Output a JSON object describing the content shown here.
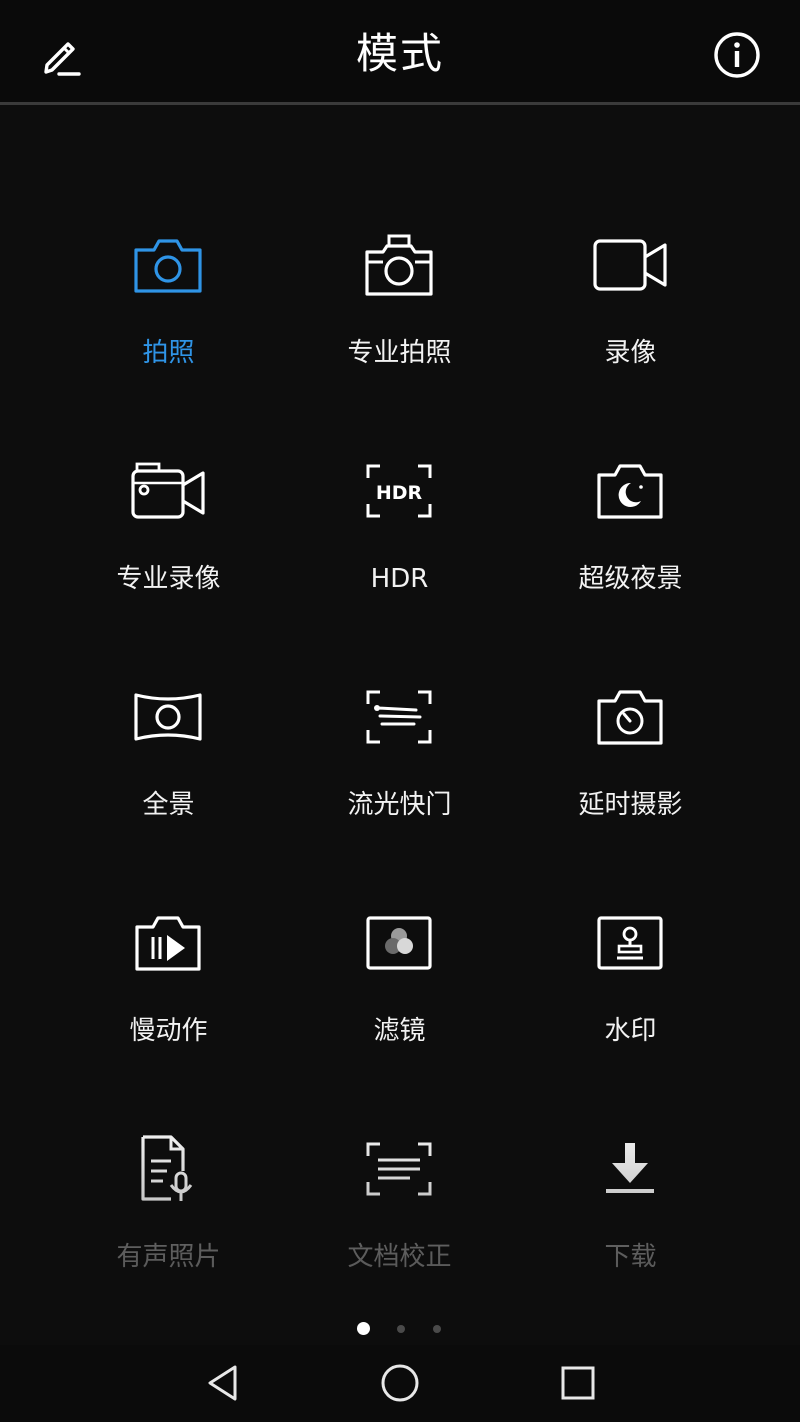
{
  "header": {
    "title": "模式",
    "edit_icon": "pencil-icon",
    "info_icon": "info-icon"
  },
  "colors": {
    "active": "#2f94e6",
    "text": "#f2f2f2",
    "dim_text": "#8a8a8a",
    "background": "#0d0d0d"
  },
  "modes": [
    {
      "label": "拍照",
      "icon": "camera-icon",
      "state": "selected"
    },
    {
      "label": "专业拍照",
      "icon": "pro-camera-icon",
      "state": "normal"
    },
    {
      "label": "录像",
      "icon": "video-camera-icon",
      "state": "normal"
    },
    {
      "label": "专业录像",
      "icon": "pro-video-icon",
      "state": "normal"
    },
    {
      "label": "HDR",
      "icon": "hdr-icon",
      "state": "normal"
    },
    {
      "label": "超级夜景",
      "icon": "night-mode-icon",
      "state": "normal"
    },
    {
      "label": "全景",
      "icon": "panorama-icon",
      "state": "normal"
    },
    {
      "label": "流光快门",
      "icon": "light-painting-icon",
      "state": "normal"
    },
    {
      "label": "延时摄影",
      "icon": "time-lapse-icon",
      "state": "normal"
    },
    {
      "label": "慢动作",
      "icon": "slow-motion-icon",
      "state": "normal"
    },
    {
      "label": "滤镜",
      "icon": "filter-icon",
      "state": "normal"
    },
    {
      "label": "水印",
      "icon": "watermark-icon",
      "state": "normal"
    },
    {
      "label": "有声照片",
      "icon": "audio-note-icon",
      "state": "dim"
    },
    {
      "label": "文档校正",
      "icon": "document-scan-icon",
      "state": "dim"
    },
    {
      "label": "下载",
      "icon": "download-icon",
      "state": "dim"
    }
  ],
  "pager": {
    "current": 1,
    "total": 3
  },
  "navbar": {
    "back_icon": "back-triangle-icon",
    "home_icon": "home-circle-icon",
    "recents_icon": "recents-square-icon"
  }
}
